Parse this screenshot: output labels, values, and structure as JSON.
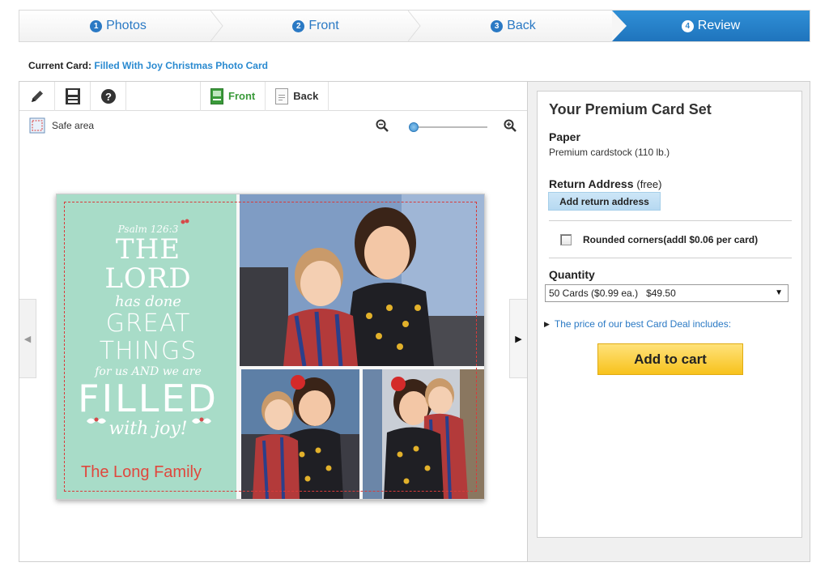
{
  "steps": [
    {
      "num": "1",
      "label": "Photos"
    },
    {
      "num": "2",
      "label": "Front"
    },
    {
      "num": "3",
      "label": "Back"
    },
    {
      "num": "4",
      "label": "Review"
    }
  ],
  "current_card": {
    "prefix": "Current Card:",
    "name": "Filled With Joy Christmas Photo Card"
  },
  "toolbar": {
    "front_label": "Front",
    "back_label": "Back",
    "icons": [
      "pencil-icon",
      "save-icon",
      "help-icon"
    ]
  },
  "editor": {
    "safe_area_label": "Safe area",
    "zoom_level": 0.05
  },
  "card": {
    "verse_ref": "Psalm 126:3",
    "line1": "THE LORD",
    "line2": "has done",
    "line3": "GREAT THINGS",
    "line4": "for us AND we are",
    "line5": "FILLED",
    "line6": "with joy!",
    "family": "The Long Family"
  },
  "panel": {
    "title": "Your Premium Card Set",
    "paper_label": "Paper",
    "paper_value": "Premium cardstock (110 lb.)",
    "return_label": "Return Address",
    "return_free": "(free)",
    "add_return_button": "Add return address",
    "rounded_label": "Rounded corners(addl $0.06 per card)",
    "quantity_label": "Quantity",
    "quantity_value": "50 Cards ($0.99 ea.)   $49.50",
    "deal_link": "The price of our best Card Deal includes:",
    "cart_button": "Add to cart"
  },
  "colors": {
    "accent": "#2f86cc",
    "mint": "#a8dcc8",
    "cart": "#f7c21c",
    "family_red": "#e0473d"
  }
}
